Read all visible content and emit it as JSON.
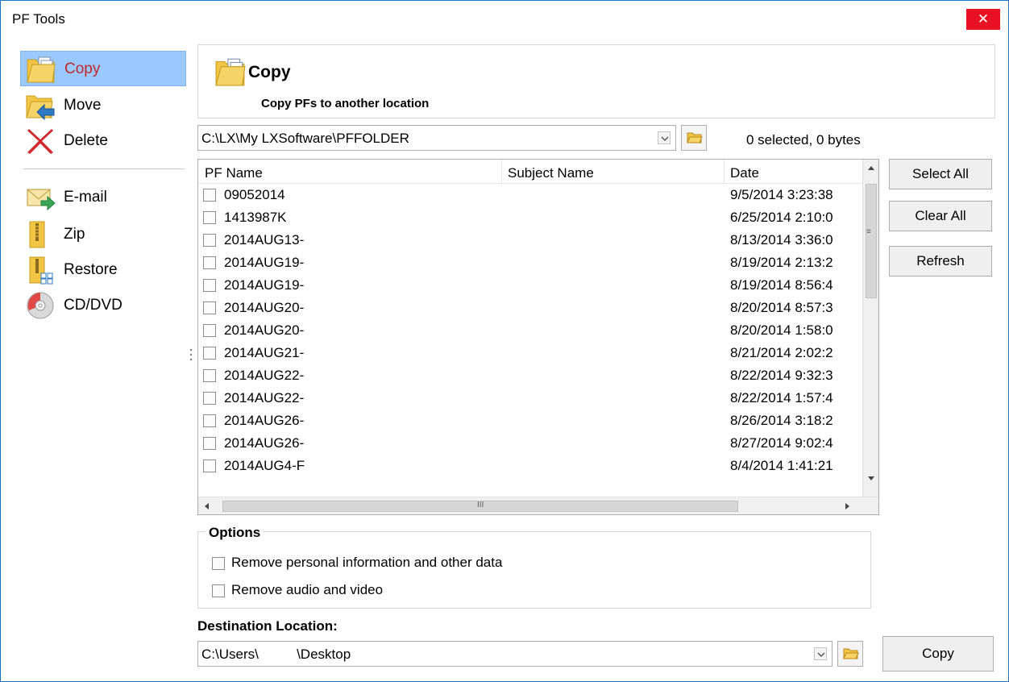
{
  "window": {
    "title": "PF Tools",
    "close_glyph": "✕"
  },
  "sidebar": {
    "items": [
      {
        "label": "Copy",
        "icon": "copy-folder-icon",
        "selected": true
      },
      {
        "label": "Move",
        "icon": "move-folder-icon",
        "selected": false
      },
      {
        "label": "Delete",
        "icon": "delete-x-icon",
        "selected": false
      },
      {
        "label": "E-mail",
        "icon": "email-icon",
        "selected": false
      },
      {
        "label": "Zip",
        "icon": "zip-folder-icon",
        "selected": false
      },
      {
        "label": "Restore",
        "icon": "restore-folder-icon",
        "selected": false
      },
      {
        "label": "CD/DVD",
        "icon": "cd-dvd-icon",
        "selected": false
      }
    ]
  },
  "header": {
    "title": "Copy",
    "description": "Copy PFs to another location"
  },
  "source": {
    "path": "C:\\LX\\My LXSoftware\\PFFOLDER",
    "status": "0 selected, 0 bytes"
  },
  "list": {
    "columns": [
      "PF Name",
      "Subject Name",
      "Date"
    ],
    "rows": [
      {
        "name": "09052014",
        "date": "9/5/2014 3:23:38"
      },
      {
        "name": "1413987K",
        "date": "6/25/2014 2:10:0"
      },
      {
        "name": "2014AUG13-",
        "date": "8/13/2014 3:36:0"
      },
      {
        "name": "2014AUG19-",
        "date": "8/19/2014 2:13:2"
      },
      {
        "name": "2014AUG19-",
        "date": "8/19/2014 8:56:4"
      },
      {
        "name": "2014AUG20-",
        "date": "8/20/2014 8:57:3"
      },
      {
        "name": "2014AUG20-",
        "date": "8/20/2014 1:58:0"
      },
      {
        "name": "2014AUG21-",
        "date": "8/21/2014 2:02:2"
      },
      {
        "name": "2014AUG22-",
        "date": "8/22/2014 9:32:3"
      },
      {
        "name": "2014AUG22-",
        "date": "8/22/2014 1:57:4"
      },
      {
        "name": "2014AUG26-",
        "date": "8/26/2014 3:18:2"
      },
      {
        "name": "2014AUG26-",
        "date": "8/27/2014 9:02:4"
      },
      {
        "name": "2014AUG4-F",
        "date": "8/4/2014 1:41:21"
      }
    ]
  },
  "buttons": {
    "select_all": "Select All",
    "clear_all": "Clear All",
    "refresh": "Refresh",
    "copy": "Copy"
  },
  "options": {
    "legend": "Options",
    "items": [
      {
        "label": "Remove personal information and other data",
        "checked": false
      },
      {
        "label": "Remove audio and video",
        "checked": false
      }
    ]
  },
  "destination": {
    "label": "Destination Location:",
    "path": "C:\\Users\\          \\Desktop"
  },
  "colors": {
    "selection": "#99c9ff",
    "selected_text": "#c1272d",
    "close": "#e81123",
    "folder": "#f3c544"
  }
}
